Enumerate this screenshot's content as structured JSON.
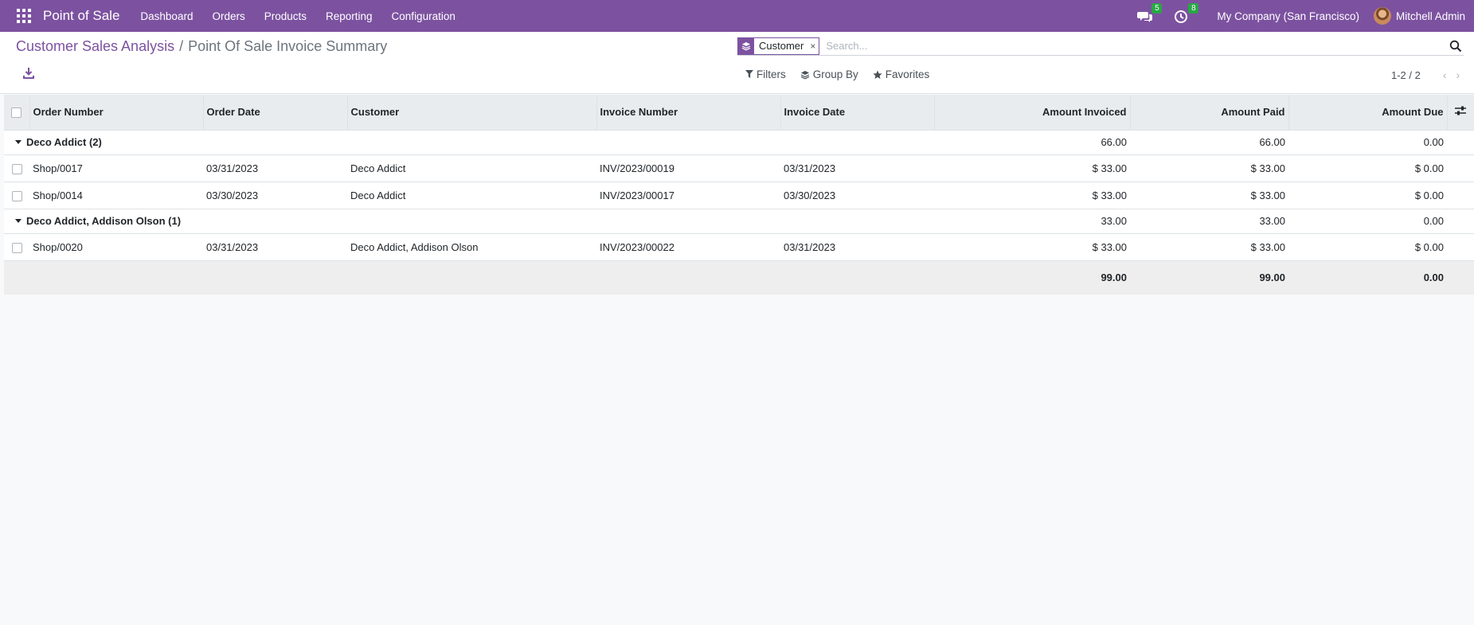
{
  "navbar": {
    "app_name": "Point of Sale",
    "menu": [
      "Dashboard",
      "Orders",
      "Products",
      "Reporting",
      "Configuration"
    ],
    "messages_count": "5",
    "activities_count": "8",
    "company": "My Company (San Francisco)",
    "user": "Mitchell Admin"
  },
  "breadcrumb": {
    "parent": "Customer Sales Analysis",
    "separator": "/",
    "current": "Point Of Sale Invoice Summary"
  },
  "search": {
    "facet_label": "Customer",
    "facet_remove": "×",
    "placeholder": "Search..."
  },
  "filters": {
    "filters_label": "Filters",
    "group_by_label": "Group By",
    "favorites_label": "Favorites"
  },
  "pager": {
    "value": "1-2 / 2"
  },
  "table": {
    "columns": [
      "Order Number",
      "Order Date",
      "Customer",
      "Invoice Number",
      "Invoice Date",
      "Amount Invoiced",
      "Amount Paid",
      "Amount Due"
    ],
    "groups": [
      {
        "label": "Deco Addict (2)",
        "amount_invoiced": "66.00",
        "amount_paid": "66.00",
        "amount_due": "0.00",
        "rows": [
          {
            "order": "Shop/0017",
            "order_date": "03/31/2023",
            "customer": "Deco Addict",
            "invoice": "INV/2023/00019",
            "invoice_date": "03/31/2023",
            "amount_invoiced": "$ 33.00",
            "amount_paid": "$ 33.00",
            "amount_due": "$ 0.00"
          },
          {
            "order": "Shop/0014",
            "order_date": "03/30/2023",
            "customer": "Deco Addict",
            "invoice": "INV/2023/00017",
            "invoice_date": "03/30/2023",
            "amount_invoiced": "$ 33.00",
            "amount_paid": "$ 33.00",
            "amount_due": "$ 0.00"
          }
        ]
      },
      {
        "label": "Deco Addict, Addison Olson (1)",
        "amount_invoiced": "33.00",
        "amount_paid": "33.00",
        "amount_due": "0.00",
        "rows": [
          {
            "order": "Shop/0020",
            "order_date": "03/31/2023",
            "customer": "Deco Addict, Addison Olson",
            "invoice": "INV/2023/00022",
            "invoice_date": "03/31/2023",
            "amount_invoiced": "$ 33.00",
            "amount_paid": "$ 33.00",
            "amount_due": "$ 0.00"
          }
        ]
      }
    ],
    "totals": {
      "amount_invoiced": "99.00",
      "amount_paid": "99.00",
      "amount_due": "0.00"
    }
  }
}
